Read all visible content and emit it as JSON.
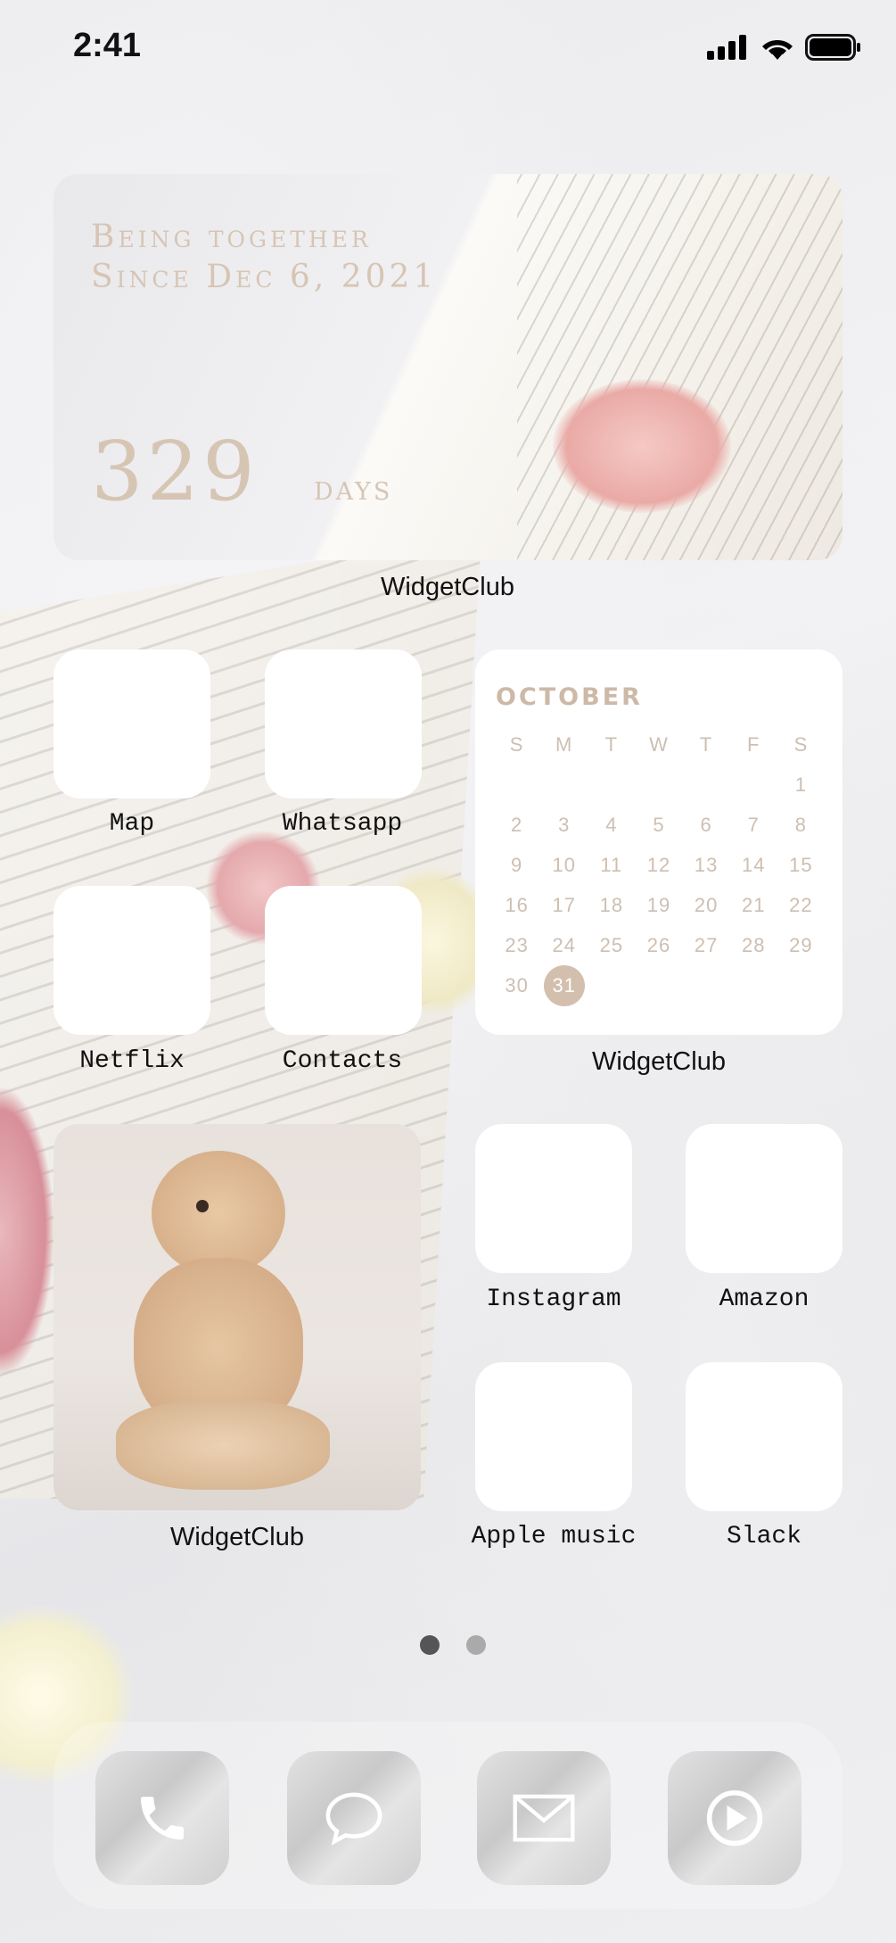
{
  "status": {
    "time": "2:41"
  },
  "anniversary_widget": {
    "line1": "Being together",
    "line2": "Since Dec 6, 2021",
    "count": "329",
    "unit": "days",
    "label": "WidgetClub"
  },
  "apps_row1": [
    {
      "label": "Map"
    },
    {
      "label": "Whatsapp"
    }
  ],
  "apps_row2": [
    {
      "label": "Netflix"
    },
    {
      "label": "Contacts"
    }
  ],
  "calendar_widget": {
    "month": "OCTOBER",
    "weekdays": [
      "S",
      "M",
      "T",
      "W",
      "T",
      "F",
      "S"
    ],
    "days": [
      "",
      "",
      "",
      "",
      "",
      "",
      "1",
      "2",
      "3",
      "4",
      "5",
      "6",
      "7",
      "8",
      "9",
      "10",
      "11",
      "12",
      "13",
      "14",
      "15",
      "16",
      "17",
      "18",
      "19",
      "20",
      "21",
      "22",
      "23",
      "24",
      "25",
      "26",
      "27",
      "28",
      "29",
      "30",
      "31"
    ],
    "today": "31",
    "label": "WidgetClub",
    "accent": "#d3bfae"
  },
  "photo_widget": {
    "label": "WidgetClub"
  },
  "apps_row3": [
    {
      "label": "Instagram"
    },
    {
      "label": "Amazon"
    }
  ],
  "apps_row4": [
    {
      "label": "Apple music"
    },
    {
      "label": "Slack"
    }
  ],
  "page_indicator": {
    "pages": 2,
    "current": 1
  },
  "dock": [
    {
      "icon": "phone-icon"
    },
    {
      "icon": "message-icon"
    },
    {
      "icon": "mail-icon"
    },
    {
      "icon": "safari-icon"
    }
  ]
}
